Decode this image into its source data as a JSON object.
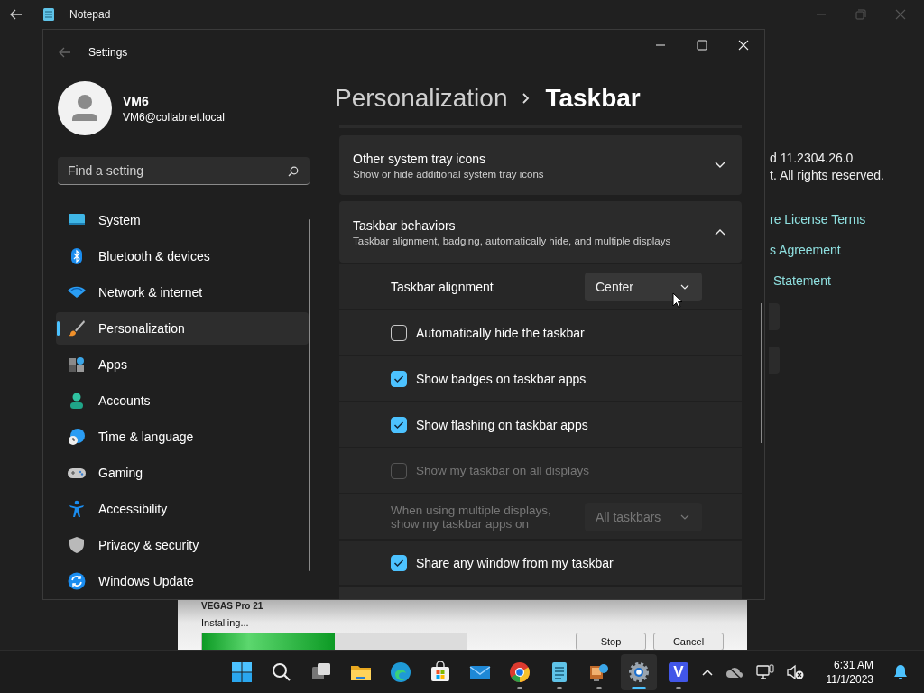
{
  "notepad": {
    "title": "Notepad",
    "about_lines": [
      "d 11.2304.26.0",
      "t. All rights reserved."
    ],
    "links": [
      "re License Terms",
      "s Agreement",
      "Statement"
    ]
  },
  "installer": {
    "title": "VEGAS Pro 21",
    "status": "Installing...",
    "level": 0.5,
    "buttons": [
      "Stop",
      "Cancel"
    ]
  },
  "settings": {
    "title": "Settings",
    "user": {
      "name": "VM6",
      "email": "VM6@collabnet.local"
    },
    "search": {
      "placeholder": "Find a setting"
    },
    "nav": [
      {
        "label": "System",
        "selected": false
      },
      {
        "label": "Bluetooth & devices",
        "selected": false
      },
      {
        "label": "Network & internet",
        "selected": false
      },
      {
        "label": "Personalization",
        "selected": true
      },
      {
        "label": "Apps",
        "selected": false
      },
      {
        "label": "Accounts",
        "selected": false
      },
      {
        "label": "Time & language",
        "selected": false
      },
      {
        "label": "Gaming",
        "selected": false
      },
      {
        "label": "Accessibility",
        "selected": false
      },
      {
        "label": "Privacy & security",
        "selected": false
      },
      {
        "label": "Windows Update",
        "selected": false
      }
    ],
    "breadcrumb": [
      "Personalization",
      "Taskbar"
    ],
    "sections": [
      {
        "title": "Other system tray icons",
        "subtitle": "Show or hide additional system tray icons",
        "expanded": false
      },
      {
        "title": "Taskbar behaviors",
        "subtitle": "Taskbar alignment, badging, automatically hide, and multiple displays",
        "expanded": true,
        "rows": [
          {
            "kind": "dropdown",
            "label": "Taskbar alignment",
            "value": "Center",
            "disabled": false
          },
          {
            "kind": "checkbox",
            "label": "Automatically hide the taskbar",
            "checked": false,
            "disabled": false
          },
          {
            "kind": "checkbox",
            "label": "Show badges on taskbar apps",
            "checked": true,
            "disabled": false
          },
          {
            "kind": "checkbox",
            "label": "Show flashing on taskbar apps",
            "checked": true,
            "disabled": false
          },
          {
            "kind": "checkbox",
            "label": "Show my taskbar on all displays",
            "checked": false,
            "disabled": true
          },
          {
            "kind": "dropdown",
            "label": "When using multiple displays, show my taskbar apps on",
            "value": "All taskbars",
            "disabled": true
          },
          {
            "kind": "checkbox",
            "label": "Share any window from my taskbar",
            "checked": true,
            "disabled": false
          }
        ]
      }
    ]
  },
  "taskbar": {
    "apps": [
      {
        "running": false,
        "active": false
      },
      {
        "running": false,
        "active": false
      },
      {
        "running": false,
        "active": false
      },
      {
        "running": false,
        "active": false
      },
      {
        "running": false,
        "active": false
      },
      {
        "running": false,
        "active": false
      },
      {
        "running": false,
        "active": false
      },
      {
        "running": true,
        "active": false
      },
      {
        "running": true,
        "active": false
      },
      {
        "running": true,
        "active": false
      },
      {
        "running": true,
        "active": true
      },
      {
        "running": true,
        "active": false,
        "letter": "V"
      }
    ],
    "time": "6:31 AM",
    "date": "11/1/2023"
  }
}
